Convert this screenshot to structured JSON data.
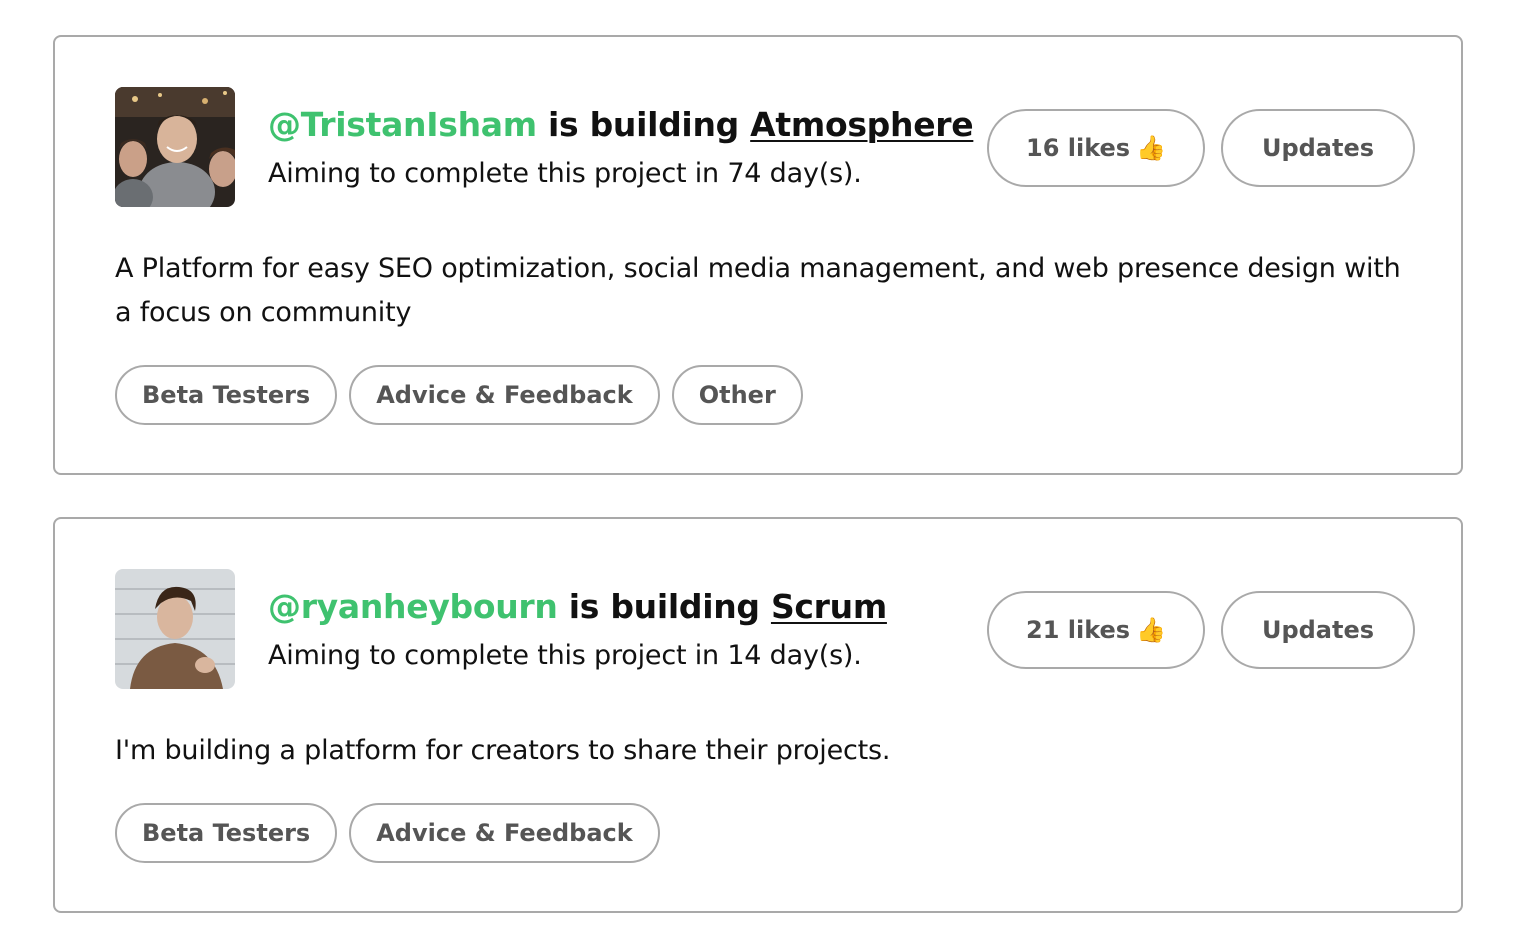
{
  "projects": [
    {
      "handle": "@TristanIsham",
      "verb": "is building",
      "project_name": "Atmosphere",
      "aim_text": "Aiming to complete this project in 74 day(s).",
      "likes_label": "16 likes",
      "likes_icon": "thumbs-up-icon",
      "updates_label": "Updates",
      "description": "A Platform for easy SEO optimization, social media management, and web presence design with a focus on community",
      "tags": [
        "Beta Testers",
        "Advice & Feedback",
        "Other"
      ]
    },
    {
      "handle": "@ryanheybourn",
      "verb": "is building",
      "project_name": "Scrum",
      "aim_text": "Aiming to complete this project in 14 day(s).",
      "likes_label": "21 likes",
      "likes_icon": "thumbs-up-icon",
      "updates_label": "Updates",
      "description": "I'm building a platform for creators to share their projects.",
      "tags": [
        "Beta Testers",
        "Advice & Feedback"
      ]
    }
  ],
  "colors": {
    "handle": "#3fc26f",
    "border": "#a9a9a9",
    "button_text": "#555555",
    "text": "#111111"
  }
}
